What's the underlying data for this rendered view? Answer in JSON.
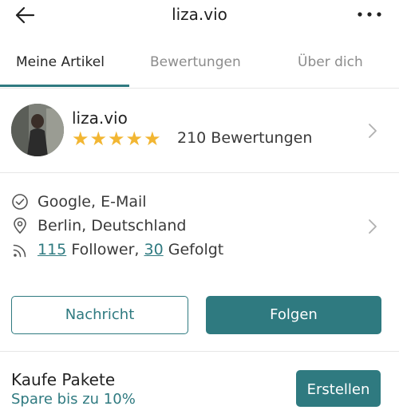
{
  "header": {
    "title": "liza.vio",
    "back_icon": "arrow-left-icon",
    "more_icon": "more-horizontal-icon"
  },
  "tabs": [
    {
      "label": "Meine Artikel",
      "active": true
    },
    {
      "label": "Bewertungen",
      "active": false
    },
    {
      "label": "Über dich",
      "active": false
    }
  ],
  "profile": {
    "username": "liza.vio",
    "rating_stars": 5,
    "reviews_label": "210 Bewertungen"
  },
  "info": {
    "verified_label": "Google, E-Mail",
    "location_label": "Berlin, Deutschland",
    "followers_count": "115",
    "followers_label": "Follower,",
    "following_count": "30",
    "following_label": "Gefolgt"
  },
  "actions": {
    "message_label": "Nachricht",
    "follow_label": "Folgen"
  },
  "bundles": {
    "title": "Kaufe Pakete",
    "subtitle": "Spare bis zu 10%",
    "create_label": "Erstellen"
  },
  "colors": {
    "accent": "#2f7a80",
    "star": "#f2b632",
    "divider": "#e6e6e6"
  }
}
